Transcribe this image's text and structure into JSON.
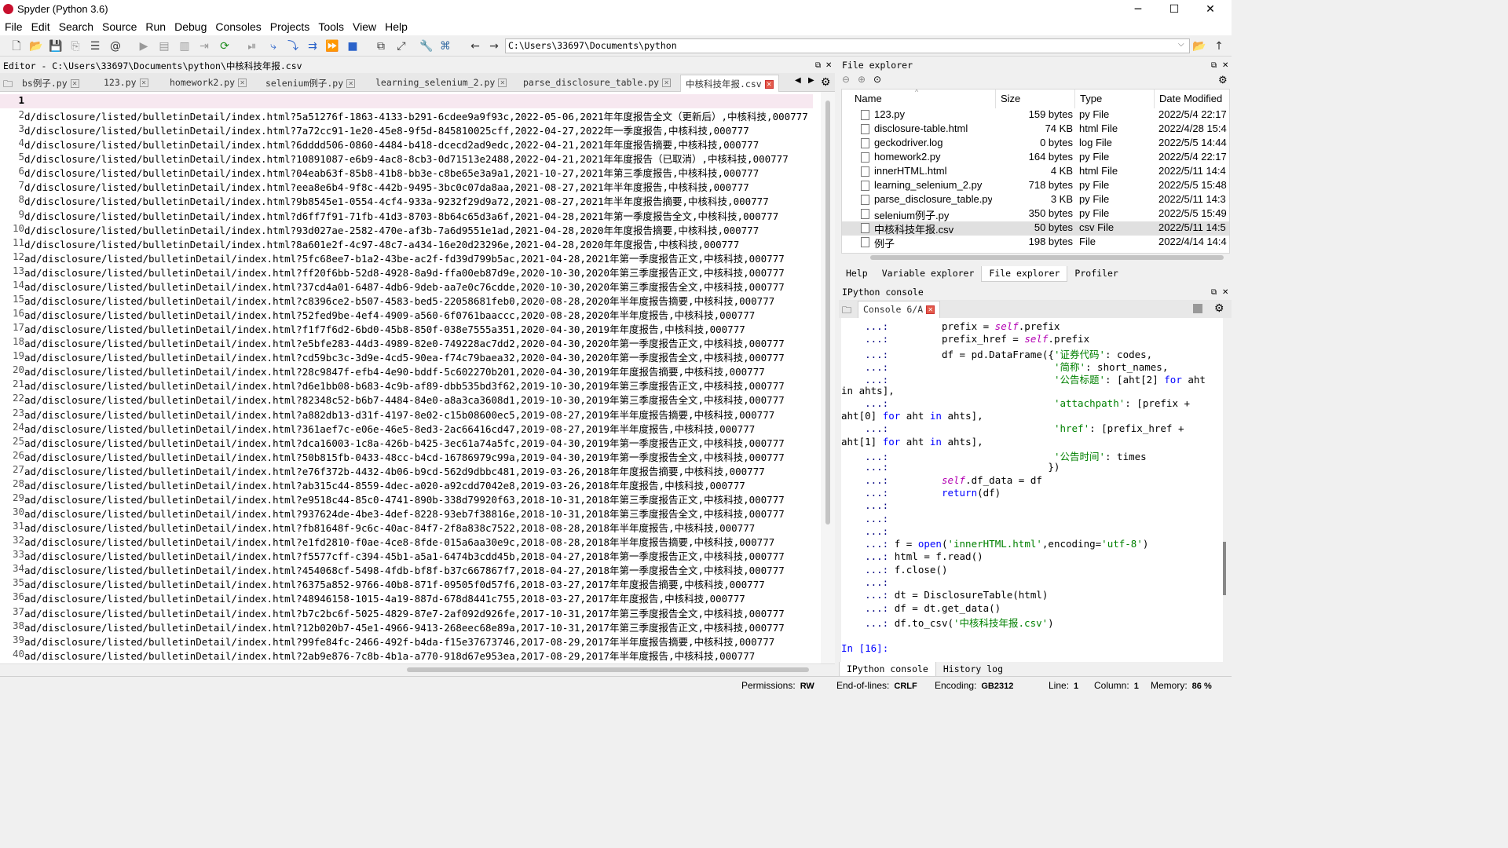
{
  "window": {
    "title": "Spyder (Python 3.6)",
    "min_icon": "minimize-icon",
    "max_icon": "maximize-icon",
    "close_icon": "close-icon",
    "min": "─",
    "max": "☐",
    "close": "✕"
  },
  "menu": [
    "File",
    "Edit",
    "Search",
    "Source",
    "Run",
    "Debug",
    "Consoles",
    "Projects",
    "Tools",
    "View",
    "Help"
  ],
  "toolbar": {
    "path": "C:\\Users\\33697\\Documents\\python"
  },
  "editor": {
    "title": "Editor - C:\\Users\\33697\\Documents\\python\\中核科技年报.csv",
    "tabs": [
      "bs例子.py",
      "123.py",
      "homework2.py",
      "selenium例子.py",
      "learning_selenium_2.py",
      "parse_disclosure_table.py",
      "中核科技年报.csv"
    ],
    "active_tab": 6,
    "line_numbers": [
      "1",
      "2",
      "3",
      "4",
      "5",
      "6",
      "7",
      "8",
      "9",
      "10",
      "11",
      "12",
      "13",
      "14",
      "15",
      "16",
      "17",
      "18",
      "19",
      "20",
      "21",
      "22",
      "23",
      "24",
      "25",
      "26",
      "27",
      "28",
      "29",
      "30",
      "31",
      "32",
      "33",
      "34",
      "35",
      "36",
      "37",
      "38",
      "39",
      "40"
    ],
    "lines": [
      "",
      "d/disclosure/listed/bulletinDetail/index.html?5a51276f-1863-4133-b291-6cdee9a9f93c,2022-05-06,2021年年度报告全文（更新后）,中核科技,000777",
      "d/disclosure/listed/bulletinDetail/index.html?7a72cc91-1e20-45e8-9f5d-845810025cff,2022-04-27,2022年一季度报告,中核科技,000777",
      "d/disclosure/listed/bulletinDetail/index.html?6dddd506-0860-4484-b418-dcecd2ad9edc,2022-04-21,2021年年度报告摘要,中核科技,000777",
      "d/disclosure/listed/bulletinDetail/index.html?10891087-e6b9-4ac8-8cb3-0d71513e2488,2022-04-21,2021年年度报告（已取消）,中核科技,000777",
      "d/disclosure/listed/bulletinDetail/index.html?04eab63f-85b8-41b8-bb3e-c8be65e3a9a1,2021-10-27,2021年第三季度报告,中核科技,000777",
      "d/disclosure/listed/bulletinDetail/index.html?eea8e6b4-9f8c-442b-9495-3bc0c07da8aa,2021-08-27,2021年半年度报告,中核科技,000777",
      "d/disclosure/listed/bulletinDetail/index.html?9b8545e1-0554-4cf4-933a-9232f29d9a72,2021-08-27,2021年半年度报告摘要,中核科技,000777",
      "d/disclosure/listed/bulletinDetail/index.html?d6ff7f91-71fb-41d3-8703-8b64c65d3a6f,2021-04-28,2021年第一季度报告全文,中核科技,000777",
      "d/disclosure/listed/bulletinDetail/index.html?93d027ae-2582-470e-af3b-7a6d9551e1ad,2021-04-28,2020年年度报告摘要,中核科技,000777",
      "d/disclosure/listed/bulletinDetail/index.html?8a601e2f-4c97-48c7-a434-16e20d23296e,2021-04-28,2020年年度报告,中核科技,000777",
      "ad/disclosure/listed/bulletinDetail/index.html?5fc68ee7-b1a2-43be-ac2f-fd39d799b5ac,2021-04-28,2021年第一季度报告正文,中核科技,000777",
      "ad/disclosure/listed/bulletinDetail/index.html?ff20f6bb-52d8-4928-8a9d-ffa00eb87d9e,2020-10-30,2020年第三季度报告正文,中核科技,000777",
      "ad/disclosure/listed/bulletinDetail/index.html?37cd4a01-6487-4db6-9deb-aa7e0c76cdde,2020-10-30,2020年第三季度报告全文,中核科技,000777",
      "ad/disclosure/listed/bulletinDetail/index.html?c8396ce2-b507-4583-bed5-22058681feb0,2020-08-28,2020年半年度报告摘要,中核科技,000777",
      "ad/disclosure/listed/bulletinDetail/index.html?52fed9be-4ef4-4909-a560-6f0761baaccc,2020-08-28,2020年半年度报告,中核科技,000777",
      "ad/disclosure/listed/bulletinDetail/index.html?f1f7f6d2-6bd0-45b8-850f-038e7555a351,2020-04-30,2019年年度报告,中核科技,000777",
      "ad/disclosure/listed/bulletinDetail/index.html?e5bfe283-44d3-4989-82e0-749228ac7dd2,2020-04-30,2020年第一季度报告正文,中核科技,000777",
      "ad/disclosure/listed/bulletinDetail/index.html?cd59bc3c-3d9e-4cd5-90ea-f74c79baea32,2020-04-30,2020年第一季度报告全文,中核科技,000777",
      "ad/disclosure/listed/bulletinDetail/index.html?28c9847f-efb4-4e90-bddf-5c602270b201,2020-04-30,2019年年度报告摘要,中核科技,000777",
      "ad/disclosure/listed/bulletinDetail/index.html?d6e1bb08-b683-4c9b-af89-dbb535bd3f62,2019-10-30,2019年第三季度报告正文,中核科技,000777",
      "ad/disclosure/listed/bulletinDetail/index.html?82348c52-b6b7-4484-84e0-a8a3ca3608d1,2019-10-30,2019年第三季度报告全文,中核科技,000777",
      "ad/disclosure/listed/bulletinDetail/index.html?a882db13-d31f-4197-8e02-c15b08600ec5,2019-08-27,2019年半年度报告摘要,中核科技,000777",
      "ad/disclosure/listed/bulletinDetail/index.html?361aef7c-e06e-46e5-8ed3-2ac66416cd47,2019-08-27,2019年半年度报告,中核科技,000777",
      "ad/disclosure/listed/bulletinDetail/index.html?dca16003-1c8a-426b-b425-3ec61a74a5fc,2019-04-30,2019年第一季度报告正文,中核科技,000777",
      "ad/disclosure/listed/bulletinDetail/index.html?50b815fb-0433-48cc-b4cd-16786979c99a,2019-04-30,2019年第一季度报告全文,中核科技,000777",
      "ad/disclosure/listed/bulletinDetail/index.html?e76f372b-4432-4b06-b9cd-562d9dbbc481,2019-03-26,2018年年度报告摘要,中核科技,000777",
      "ad/disclosure/listed/bulletinDetail/index.html?ab315c44-8559-4dec-a020-a92cdd7042e8,2019-03-26,2018年年度报告,中核科技,000777",
      "ad/disclosure/listed/bulletinDetail/index.html?e9518c44-85c0-4741-890b-338d79920f63,2018-10-31,2018年第三季度报告正文,中核科技,000777",
      "ad/disclosure/listed/bulletinDetail/index.html?937624de-4be3-4def-8228-93eb7f38816e,2018-10-31,2018年第三季度报告全文,中核科技,000777",
      "ad/disclosure/listed/bulletinDetail/index.html?fb81648f-9c6c-40ac-84f7-2f8a838c7522,2018-08-28,2018年半年度报告,中核科技,000777",
      "ad/disclosure/listed/bulletinDetail/index.html?e1fd2810-f0ae-4ce8-8fde-015a6aa30e9c,2018-08-28,2018年半年度报告摘要,中核科技,000777",
      "ad/disclosure/listed/bulletinDetail/index.html?f5577cff-c394-45b1-a5a1-6474b3cdd45b,2018-04-27,2018年第一季度报告正文,中核科技,000777",
      "ad/disclosure/listed/bulletinDetail/index.html?454068cf-5498-4fdb-bf8f-b37c667867f7,2018-04-27,2018年第一季度报告全文,中核科技,000777",
      "ad/disclosure/listed/bulletinDetail/index.html?6375a852-9766-40b8-871f-09505f0d57f6,2018-03-27,2017年年度报告摘要,中核科技,000777",
      "ad/disclosure/listed/bulletinDetail/index.html?48946158-1015-4a19-887d-678d8441c755,2018-03-27,2017年年度报告,中核科技,000777",
      "ad/disclosure/listed/bulletinDetail/index.html?b7c2bc6f-5025-4829-87e7-2af092d926fe,2017-10-31,2017年第三季度报告全文,中核科技,000777",
      "ad/disclosure/listed/bulletinDetail/index.html?12b020b7-45e1-4966-9413-268eec68e89a,2017-10-31,2017年第三季度报告正文,中核科技,000777",
      "ad/disclosure/listed/bulletinDetail/index.html?99fe84fc-2466-492f-b4da-f15e37673746,2017-08-29,2017年半年度报告摘要,中核科技,000777",
      "ad/disclosure/listed/bulletinDetail/index.html?2ab9e876-7c8b-4b1a-a770-918d67e953ea,2017-08-29,2017年半年度报告,中核科技,000777"
    ]
  },
  "file_explorer": {
    "title": "File explorer",
    "columns": [
      "Name",
      "Size",
      "Type",
      "Date Modified"
    ],
    "rows": [
      {
        "name": "123.py",
        "size": "159 bytes",
        "type": "py File",
        "date": "2022/5/4 22:17"
      },
      {
        "name": "disclosure-table.html",
        "size": "74 KB",
        "type": "html File",
        "date": "2022/4/28 15:4"
      },
      {
        "name": "geckodriver.log",
        "size": "0 bytes",
        "type": "log File",
        "date": "2022/5/5 14:44"
      },
      {
        "name": "homework2.py",
        "size": "164 bytes",
        "type": "py File",
        "date": "2022/5/4 22:17"
      },
      {
        "name": "innerHTML.html",
        "size": "4 KB",
        "type": "html File",
        "date": "2022/5/11 14:4"
      },
      {
        "name": "learning_selenium_2.py",
        "size": "718 bytes",
        "type": "py File",
        "date": "2022/5/5 15:48"
      },
      {
        "name": "parse_disclosure_table.py",
        "size": "3 KB",
        "type": "py File",
        "date": "2022/5/11 14:3"
      },
      {
        "name": "selenium例子.py",
        "size": "350 bytes",
        "type": "py File",
        "date": "2022/5/5 15:49"
      },
      {
        "name": "中核科技年报.csv",
        "size": "50 bytes",
        "type": "csv File",
        "date": "2022/5/11 14:5"
      },
      {
        "name": "例子",
        "size": "198 bytes",
        "type": "File",
        "date": "2022/4/14 14:4"
      }
    ],
    "selected_row": 8,
    "tabs": [
      "Help",
      "Variable explorer",
      "File explorer",
      "Profiler"
    ],
    "active_tab": 2
  },
  "console": {
    "title": "IPython console",
    "tab": "Console 6/A",
    "tabs": [
      "IPython console",
      "History log"
    ],
    "active_tab": 0,
    "lines": [
      [
        [
          "pr",
          "    ...: "
        ],
        [
          "",
          "        prefix = "
        ],
        [
          "self",
          "self"
        ],
        [
          "",
          ".prefix"
        ]
      ],
      [
        [
          "pr",
          "    ...: "
        ],
        [
          "",
          "        prefix_href = "
        ],
        [
          "self",
          "self"
        ],
        [
          "",
          ".prefix"
        ]
      ],
      [
        [
          "pr",
          "    ...: "
        ],
        [
          "",
          "        df = pd.DataFrame({"
        ],
        [
          "st",
          "'证券代码'"
        ],
        [
          "",
          ": codes,"
        ]
      ],
      [
        [
          "pr",
          "    ...: "
        ],
        [
          "",
          "                           "
        ],
        [
          "st",
          "'简称'"
        ],
        [
          "",
          ": short_names,"
        ]
      ],
      [
        [
          "pr",
          "    ...: "
        ],
        [
          "",
          "                           "
        ],
        [
          "st",
          "'公告标题'"
        ],
        [
          "",
          ": [aht[2] "
        ],
        [
          "kw",
          "for"
        ],
        [
          "",
          " aht"
        ]
      ],
      [
        [
          "",
          "in"
        ],
        [
          "",
          " ahts],"
        ]
      ],
      [
        [
          "pr",
          "    ...: "
        ],
        [
          "",
          "                           "
        ],
        [
          "st",
          "'attachpath'"
        ],
        [
          "",
          ": [prefix +"
        ]
      ],
      [
        [
          "",
          "aht[0] "
        ],
        [
          "kw",
          "for"
        ],
        [
          "",
          " aht "
        ],
        [
          "kw",
          "in"
        ],
        [
          "",
          " ahts],"
        ]
      ],
      [
        [
          "pr",
          "    ...: "
        ],
        [
          "",
          "                           "
        ],
        [
          "st",
          "'href'"
        ],
        [
          "",
          ": [prefix_href +"
        ]
      ],
      [
        [
          "",
          "aht[1] "
        ],
        [
          "kw",
          "for"
        ],
        [
          "",
          " aht "
        ],
        [
          "kw",
          "in"
        ],
        [
          "",
          " ahts],"
        ]
      ],
      [
        [
          "pr",
          "    ...: "
        ],
        [
          "",
          "                           "
        ],
        [
          "st",
          "'公告时间'"
        ],
        [
          "",
          ": times"
        ]
      ],
      [
        [
          "pr",
          "    ...: "
        ],
        [
          "",
          "                          })"
        ]
      ],
      [
        [
          "pr",
          "    ...: "
        ],
        [
          "",
          "        "
        ],
        [
          "self",
          "self"
        ],
        [
          "",
          ".df_data = df"
        ]
      ],
      [
        [
          "pr",
          "    ...: "
        ],
        [
          "",
          "        "
        ],
        [
          "kw",
          "return"
        ],
        [
          "",
          "(df)"
        ]
      ],
      [
        [
          "pr",
          "    ...: "
        ]
      ],
      [
        [
          "pr",
          "    ...: "
        ]
      ],
      [
        [
          "pr",
          "    ...: "
        ]
      ],
      [
        [
          "pr",
          "    ...: "
        ],
        [
          "",
          "f = "
        ],
        [
          "kw",
          "open"
        ],
        [
          "",
          "("
        ],
        [
          "st",
          "'innerHTML.html'"
        ],
        [
          "",
          ",encoding="
        ],
        [
          "st",
          "'utf-8'"
        ],
        [
          "",
          ")"
        ]
      ],
      [
        [
          "pr",
          "    ...: "
        ],
        [
          "",
          "html = f.read()"
        ]
      ],
      [
        [
          "pr",
          "    ...: "
        ],
        [
          "",
          "f.close()"
        ]
      ],
      [
        [
          "pr",
          "    ...: "
        ]
      ],
      [
        [
          "pr",
          "    ...: "
        ],
        [
          "",
          "dt = DisclosureTable(html)"
        ]
      ],
      [
        [
          "pr",
          "    ...: "
        ],
        [
          "",
          "df = dt.get_data()"
        ]
      ],
      [
        [
          "pr",
          "    ...: "
        ],
        [
          "",
          "df.to_csv("
        ],
        [
          "st",
          "'中核科技年报.csv'"
        ],
        [
          "",
          ")"
        ]
      ],
      [],
      [
        [
          "kw",
          "In ["
        ],
        [
          "kw",
          "16"
        ],
        [
          "kw",
          "]:"
        ]
      ]
    ]
  },
  "status": {
    "permissions_label": "Permissions:",
    "permissions": "RW",
    "eol_label": "End-of-lines:",
    "eol": "CRLF",
    "encoding_label": "Encoding:",
    "encoding": "GB2312",
    "line_label": "Line:",
    "line": "1",
    "column_label": "Column:",
    "column": "1",
    "memory_label": "Memory:",
    "memory": "86 %"
  }
}
